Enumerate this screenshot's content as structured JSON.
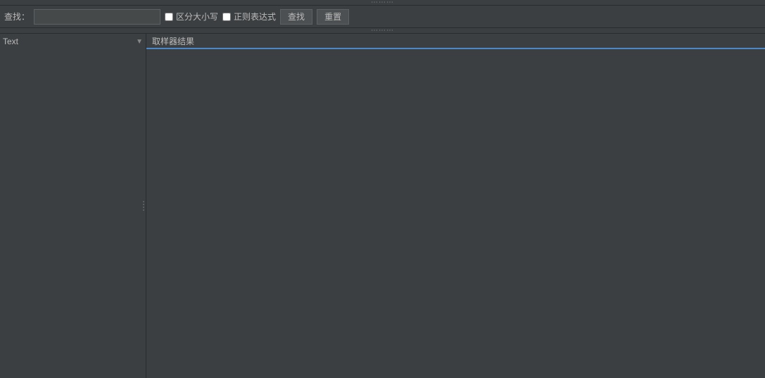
{
  "topDragHandle": {
    "dots": "∿∿∿"
  },
  "searchBar": {
    "label": "查找：",
    "inputPlaceholder": "",
    "inputValue": "",
    "caseSensitiveLabel": "区分大小写",
    "regexLabel": "正则表达式",
    "searchButtonLabel": "查找",
    "resetButtonLabel": "重置"
  },
  "midDragHandle": {
    "dots": "∿∿∿"
  },
  "leftPanel": {
    "itemText": "Text",
    "dropdownArrow": "▼"
  },
  "rightPanel": {
    "title": "取样器结果"
  },
  "colors": {
    "background": "#3c3f41",
    "border": "#2b2b2b",
    "accent": "#4a88c7",
    "text": "#bbbbbb",
    "inputBg": "#45494a",
    "buttonBg": "#4c5052"
  }
}
